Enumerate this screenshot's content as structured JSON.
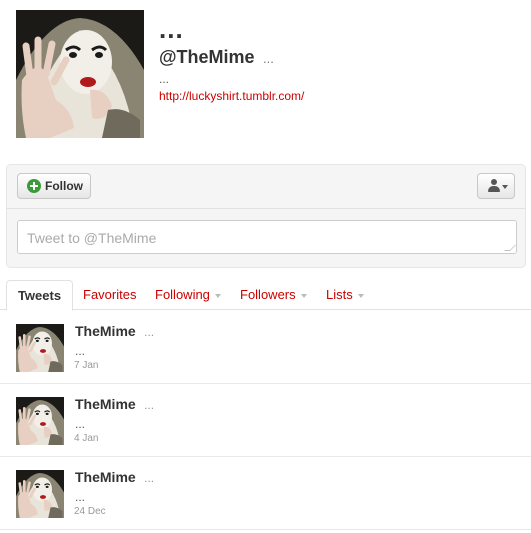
{
  "profile": {
    "name": "...",
    "handle": "@TheMime",
    "handle_extra": "...",
    "bio": "...",
    "url": "http://luckyshirt.tumblr.com/",
    "avatar_icon": "mime-avatar-icon"
  },
  "actions": {
    "follow_label": "Follow",
    "follow_icon": "plus-circle-icon",
    "user_menu_icon": "person-icon",
    "tweet_placeholder": "Tweet to @TheMime"
  },
  "tabs": [
    {
      "label": "Tweets",
      "active": true
    },
    {
      "label": "Favorites",
      "active": false
    },
    {
      "label": "Following",
      "dropdown": true
    },
    {
      "label": "Followers",
      "dropdown": true
    },
    {
      "label": "Lists",
      "dropdown": true
    }
  ],
  "tweets": [
    {
      "name": "TheMime",
      "name_extra": "...",
      "text": "...",
      "time": "7 Jan"
    },
    {
      "name": "TheMime",
      "name_extra": "...",
      "text": "...",
      "time": "4 Jan"
    },
    {
      "name": "TheMime",
      "name_extra": "...",
      "text": "...",
      "time": "24 Dec"
    }
  ],
  "colors": {
    "link": "#cc0000",
    "follow_icon": "#3b9a3b",
    "text": "#333333",
    "muted": "#999999"
  }
}
